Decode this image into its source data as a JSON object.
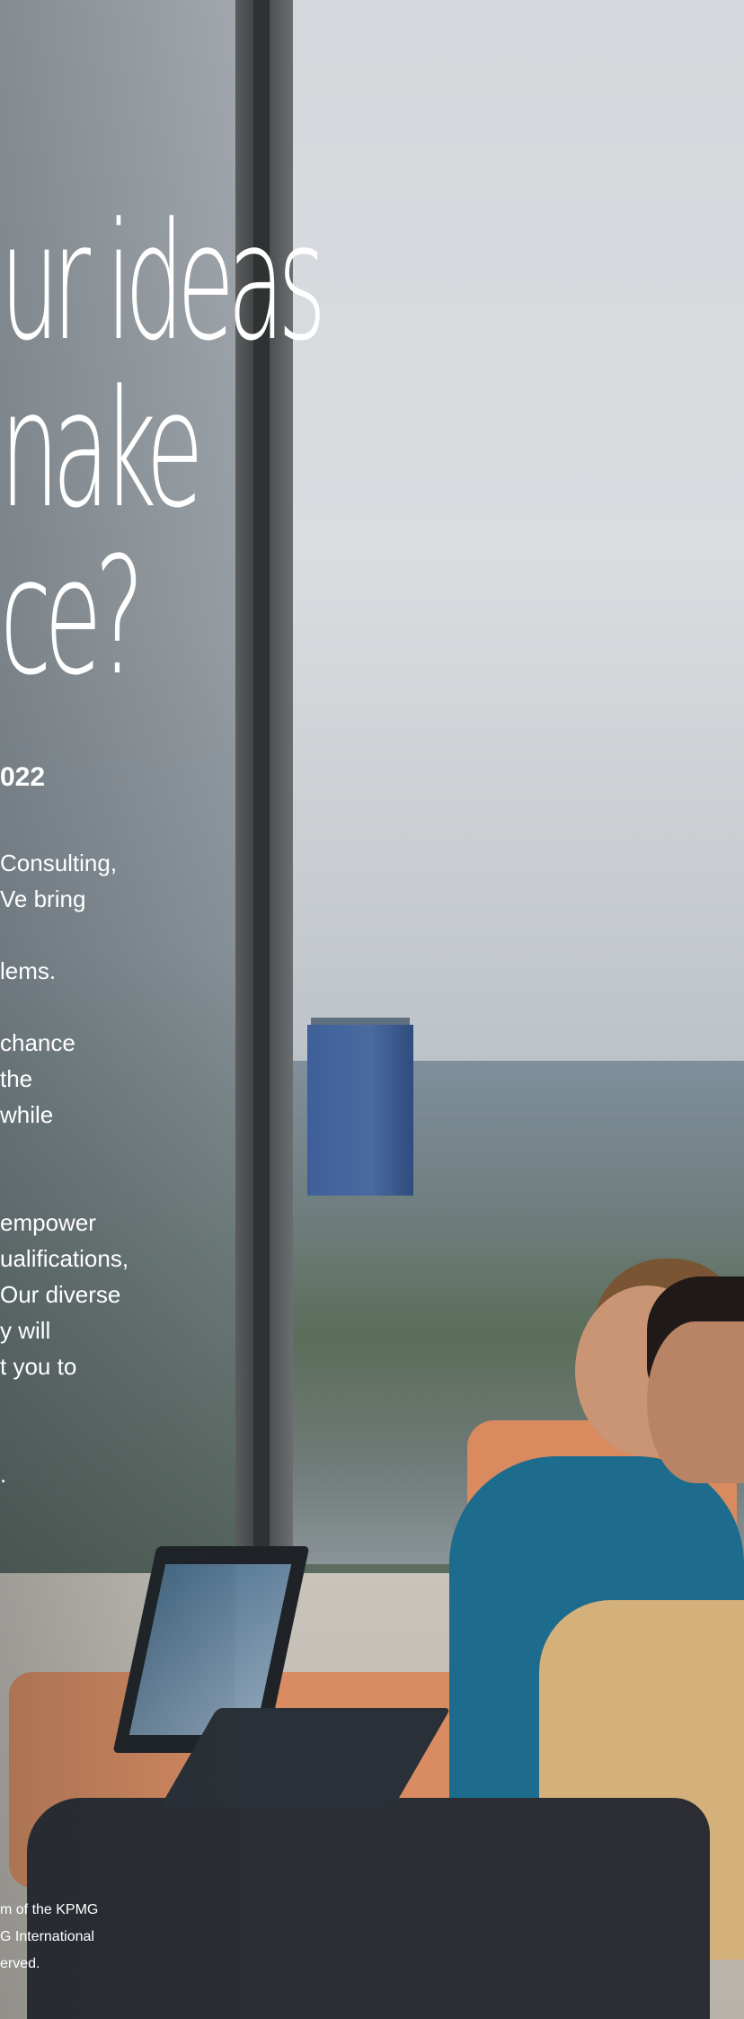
{
  "headline": {
    "line1": "ur ideas",
    "line2": "nake",
    "line3": "ce?"
  },
  "subhead": "022",
  "body": {
    "p1": [
      " Consulting,",
      "Ve bring"
    ],
    "p2": [
      "lems."
    ],
    "p3": [
      "chance",
      " the",
      "while"
    ],
    "p4": [
      "empower",
      "ualifications,",
      "Our diverse",
      "y will",
      "t you to"
    ],
    "p5": [
      "."
    ]
  },
  "footer": [
    "m of the KPMG",
    "G International",
    "erved."
  ],
  "colors": {
    "text": "#ffffff",
    "sofa": "#d98c61",
    "sweater": "#1e6c8d"
  }
}
